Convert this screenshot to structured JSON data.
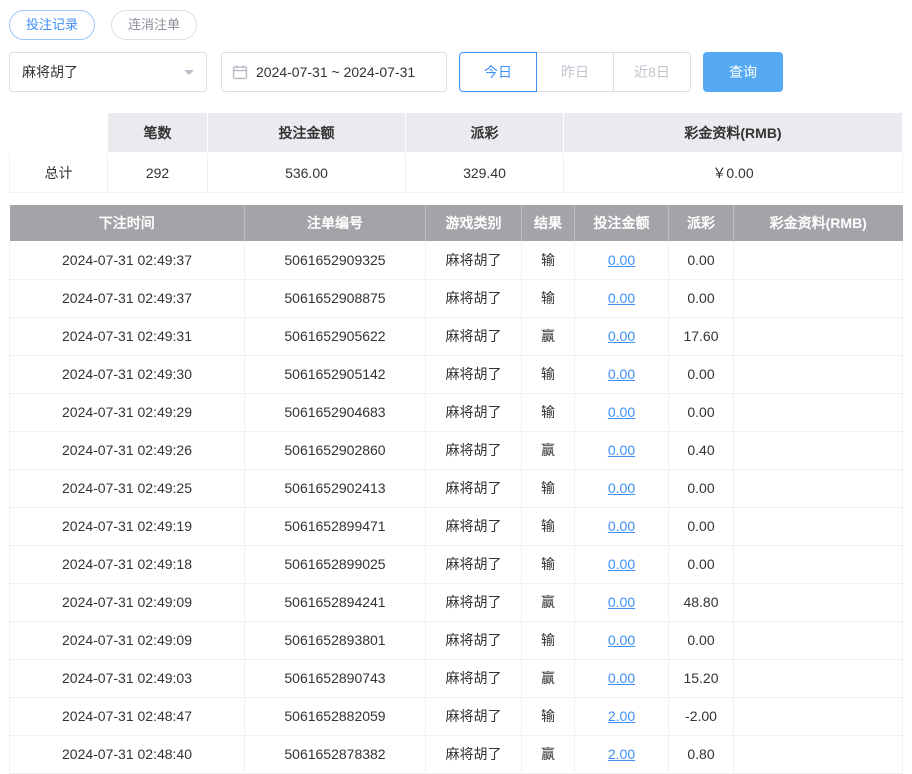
{
  "colors": {
    "accent": "#3e8ef7",
    "search_button_bg": "#55a8f2",
    "table_header_bg": "#a2a4a8",
    "negative_value": "#f0564a",
    "summary_header_bg": "#e9ebef"
  },
  "tabs": [
    {
      "label": "投注记录",
      "active": true
    },
    {
      "label": "连消注单",
      "active": false
    }
  ],
  "filters": {
    "game_select_value": "麻将胡了",
    "date_range_value": "2024-07-31 ~ 2024-07-31",
    "quick_buttons": [
      {
        "label": "今日",
        "active": true
      },
      {
        "label": "昨日",
        "active": false
      },
      {
        "label": "近8日",
        "active": false
      }
    ],
    "search_label": "查询"
  },
  "summary": {
    "headers": [
      "",
      "笔数",
      "投注金额",
      "派彩",
      "彩金资料(RMB)"
    ],
    "row_label": "总计",
    "count": "292",
    "bet_amount": "536.00",
    "payout": "329.40",
    "bonus": "￥0.00"
  },
  "table": {
    "headers": [
      "下注时间",
      "注单编号",
      "游戏类别",
      "结果",
      "投注金额",
      "派彩",
      "彩金资料(RMB)"
    ],
    "rows": [
      {
        "time": "2024-07-31 02:49:37",
        "order": "5061652909325",
        "game": "麻将胡了",
        "result": "输",
        "bet": "0.00",
        "payout": "0.00",
        "bonus": ""
      },
      {
        "time": "2024-07-31 02:49:37",
        "order": "5061652908875",
        "game": "麻将胡了",
        "result": "输",
        "bet": "0.00",
        "payout": "0.00",
        "bonus": ""
      },
      {
        "time": "2024-07-31 02:49:31",
        "order": "5061652905622",
        "game": "麻将胡了",
        "result": "赢",
        "bet": "0.00",
        "payout": "17.60",
        "bonus": ""
      },
      {
        "time": "2024-07-31 02:49:30",
        "order": "5061652905142",
        "game": "麻将胡了",
        "result": "输",
        "bet": "0.00",
        "payout": "0.00",
        "bonus": ""
      },
      {
        "time": "2024-07-31 02:49:29",
        "order": "5061652904683",
        "game": "麻将胡了",
        "result": "输",
        "bet": "0.00",
        "payout": "0.00",
        "bonus": ""
      },
      {
        "time": "2024-07-31 02:49:26",
        "order": "5061652902860",
        "game": "麻将胡了",
        "result": "赢",
        "bet": "0.00",
        "payout": "0.40",
        "bonus": ""
      },
      {
        "time": "2024-07-31 02:49:25",
        "order": "5061652902413",
        "game": "麻将胡了",
        "result": "输",
        "bet": "0.00",
        "payout": "0.00",
        "bonus": ""
      },
      {
        "time": "2024-07-31 02:49:19",
        "order": "5061652899471",
        "game": "麻将胡了",
        "result": "输",
        "bet": "0.00",
        "payout": "0.00",
        "bonus": ""
      },
      {
        "time": "2024-07-31 02:49:18",
        "order": "5061652899025",
        "game": "麻将胡了",
        "result": "输",
        "bet": "0.00",
        "payout": "0.00",
        "bonus": ""
      },
      {
        "time": "2024-07-31 02:49:09",
        "order": "5061652894241",
        "game": "麻将胡了",
        "result": "赢",
        "bet": "0.00",
        "payout": "48.80",
        "bonus": ""
      },
      {
        "time": "2024-07-31 02:49:09",
        "order": "5061652893801",
        "game": "麻将胡了",
        "result": "输",
        "bet": "0.00",
        "payout": "0.00",
        "bonus": ""
      },
      {
        "time": "2024-07-31 02:49:03",
        "order": "5061652890743",
        "game": "麻将胡了",
        "result": "赢",
        "bet": "0.00",
        "payout": "15.20",
        "bonus": ""
      },
      {
        "time": "2024-07-31 02:48:47",
        "order": "5061652882059",
        "game": "麻将胡了",
        "result": "输",
        "bet": "2.00",
        "payout": "-2.00",
        "bonus": ""
      },
      {
        "time": "2024-07-31 02:48:40",
        "order": "5061652878382",
        "game": "麻将胡了",
        "result": "赢",
        "bet": "2.00",
        "payout": "0.80",
        "bonus": ""
      }
    ]
  }
}
